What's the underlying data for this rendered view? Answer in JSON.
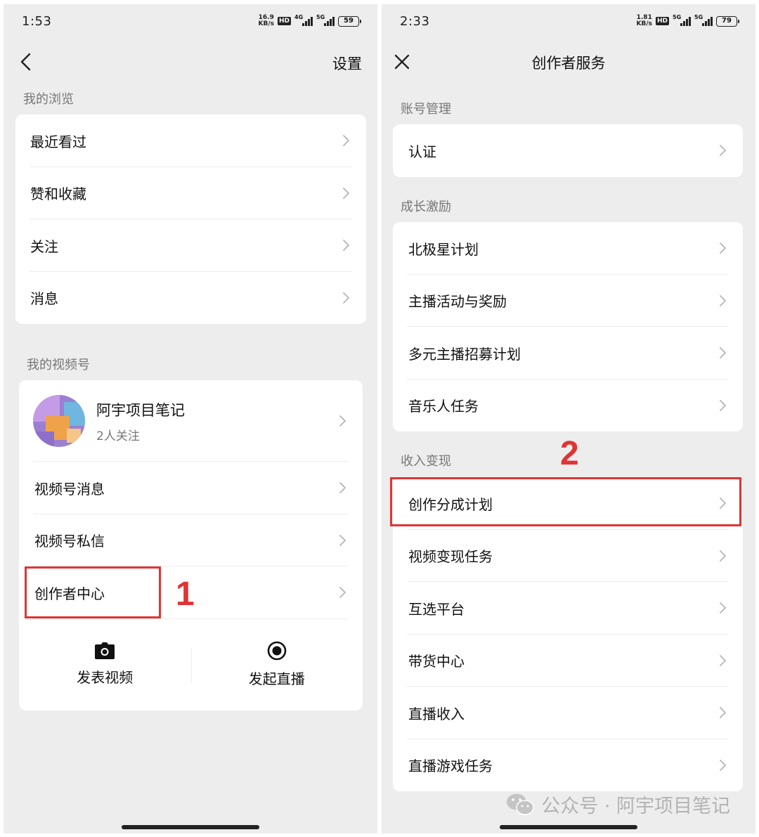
{
  "left": {
    "status": {
      "time": "1:53",
      "net_speed_top": "16.9",
      "net_speed_bottom": "KB/s",
      "hd": "HD",
      "sig1": "4G",
      "sig2": "5G",
      "battery": "59"
    },
    "nav": {
      "right_text": "设置"
    },
    "browse_section": "我的浏览",
    "browse_items": [
      {
        "label": "最近看过"
      },
      {
        "label": "赞和收藏"
      },
      {
        "label": "关注"
      },
      {
        "label": "消息"
      }
    ],
    "channel_section": "我的视频号",
    "profile": {
      "name": "阿宇项目笔记",
      "followers": "2人关注"
    },
    "channel_items": [
      {
        "label": "视频号消息"
      },
      {
        "label": "视频号私信"
      },
      {
        "label": "创作者中心"
      }
    ],
    "actions": {
      "post_video": "发表视频",
      "go_live": "发起直播"
    },
    "step": "1"
  },
  "right": {
    "status": {
      "time": "2:33",
      "net_speed_top": "1.81",
      "net_speed_bottom": "KB/s",
      "hd": "HD",
      "sig1": "5G",
      "sig2": "5G",
      "battery": "79"
    },
    "nav": {
      "title": "创作者服务"
    },
    "account_section": "账号管理",
    "account_items": [
      {
        "label": "认证"
      }
    ],
    "growth_section": "成长激励",
    "growth_items": [
      {
        "label": "北极星计划"
      },
      {
        "label": "主播活动与奖励"
      },
      {
        "label": "多元主播招募计划"
      },
      {
        "label": "音乐人任务"
      }
    ],
    "income_section": "收入变现",
    "income_items": [
      {
        "label": "创作分成计划"
      },
      {
        "label": "视频变现任务"
      },
      {
        "label": "互选平台"
      },
      {
        "label": "带货中心"
      },
      {
        "label": "直播收入"
      },
      {
        "label": "直播游戏任务"
      }
    ],
    "step": "2"
  },
  "watermark": "公众号 · 阿宇项目笔记",
  "colors": {
    "highlight": "#e03434",
    "background": "#ededed",
    "card": "#ffffff"
  }
}
